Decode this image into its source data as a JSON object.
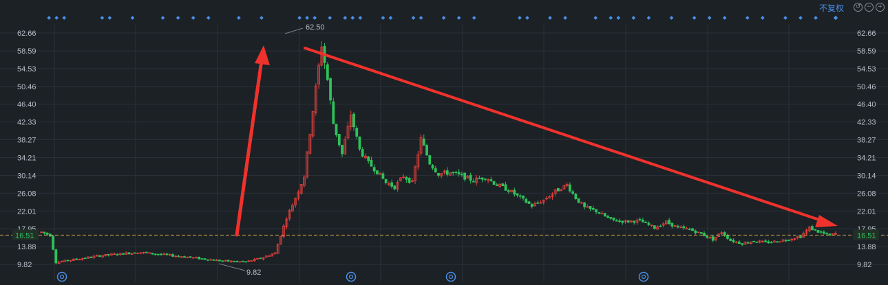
{
  "toolbar": {
    "restore_label": "不复权",
    "icons": [
      "undo-icon",
      "zoom-out-icon",
      "zoom-in-icon"
    ]
  },
  "colors": {
    "background": "#1c2126",
    "grid": "#2b3138",
    "up": "#e8413c",
    "down": "#2ec25a",
    "axis_text": "#b8bec6",
    "current_price_line": "#c8a14a",
    "current_price_text": "#2ec25a",
    "marker_dots": "#4a8fe7",
    "annotation_arrows": "#f0322c"
  },
  "chart_data": {
    "type": "candlestick",
    "y_ticks": [
      "62.66",
      "58.59",
      "54.53",
      "50.46",
      "46.40",
      "42.33",
      "38.27",
      "34.21",
      "30.14",
      "26.08",
      "22.01",
      "17.95",
      "13.88",
      "9.82"
    ],
    "ylim": [
      9.82,
      62.66
    ],
    "max_label": "62.50",
    "min_label": "9.82",
    "current_price": "16.51",
    "grid": true,
    "markers_row": "top",
    "event_icons_count": 4,
    "annotations": [
      "arrow-up",
      "arrow-down"
    ],
    "price_path": [
      [
        0,
        17.2
      ],
      [
        3,
        16.5
      ],
      [
        5,
        10.3
      ],
      [
        20,
        11.8
      ],
      [
        33,
        12.6
      ],
      [
        47,
        11.7
      ],
      [
        62,
        10.6
      ],
      [
        70,
        10.4
      ],
      [
        75,
        11.2
      ],
      [
        80,
        12.4
      ],
      [
        84,
        20.5
      ],
      [
        87,
        25.0
      ],
      [
        90,
        30.0
      ],
      [
        93,
        45.0
      ],
      [
        96,
        60.0
      ],
      [
        98,
        52.0
      ],
      [
        100,
        42.0
      ],
      [
        103,
        35.0
      ],
      [
        106,
        44.0
      ],
      [
        109,
        36.0
      ],
      [
        112,
        33.0
      ],
      [
        115,
        31.0
      ],
      [
        118,
        28.5
      ],
      [
        121,
        27.5
      ],
      [
        124,
        30.0
      ],
      [
        127,
        28.5
      ],
      [
        130,
        38.5
      ],
      [
        133,
        33.0
      ],
      [
        136,
        30.5
      ],
      [
        140,
        30.8
      ],
      [
        144,
        30.0
      ],
      [
        148,
        29.0
      ],
      [
        152,
        29.8
      ],
      [
        156,
        28.0
      ],
      [
        160,
        26.8
      ],
      [
        164,
        25.0
      ],
      [
        168,
        23.2
      ],
      [
        172,
        24.5
      ],
      [
        176,
        26.5
      ],
      [
        180,
        28.0
      ],
      [
        183,
        25.0
      ],
      [
        186,
        22.8
      ],
      [
        190,
        22.0
      ],
      [
        195,
        20.0
      ],
      [
        200,
        19.6
      ],
      [
        205,
        19.8
      ],
      [
        210,
        18.2
      ],
      [
        214,
        19.5
      ],
      [
        218,
        18.2
      ],
      [
        222,
        17.8
      ],
      [
        226,
        16.8
      ],
      [
        230,
        15.5
      ],
      [
        233,
        17.2
      ],
      [
        236,
        15.3
      ],
      [
        240,
        14.6
      ],
      [
        244,
        15.2
      ],
      [
        248,
        14.8
      ],
      [
        252,
        15.1
      ],
      [
        256,
        15.6
      ],
      [
        260,
        16.2
      ],
      [
        263,
        18.2
      ],
      [
        266,
        17.3
      ],
      [
        270,
        16.4
      ],
      [
        272,
        16.9
      ]
    ],
    "candle_count": 273,
    "up_markers": [
      1,
      2,
      3,
      8,
      9,
      12,
      16,
      18,
      20,
      22,
      26,
      29,
      34,
      35,
      36,
      38,
      40,
      41,
      42,
      45,
      46,
      49,
      50,
      53,
      55,
      57,
      63,
      64,
      67,
      69,
      73,
      75,
      76,
      78,
      80,
      83,
      86,
      88,
      90,
      93,
      95,
      98,
      100,
      102,
      106,
      108,
      113,
      115,
      118,
      120,
      125,
      127,
      130,
      132,
      134,
      136,
      141,
      145,
      150,
      152,
      154,
      158,
      160,
      163,
      166,
      169,
      171,
      173,
      177,
      181,
      184,
      189,
      193,
      196,
      198,
      201,
      207,
      209,
      211,
      214,
      216,
      219,
      224,
      227,
      230,
      232,
      237,
      243,
      245,
      249,
      252,
      255,
      257,
      260,
      263,
      265
    ]
  }
}
